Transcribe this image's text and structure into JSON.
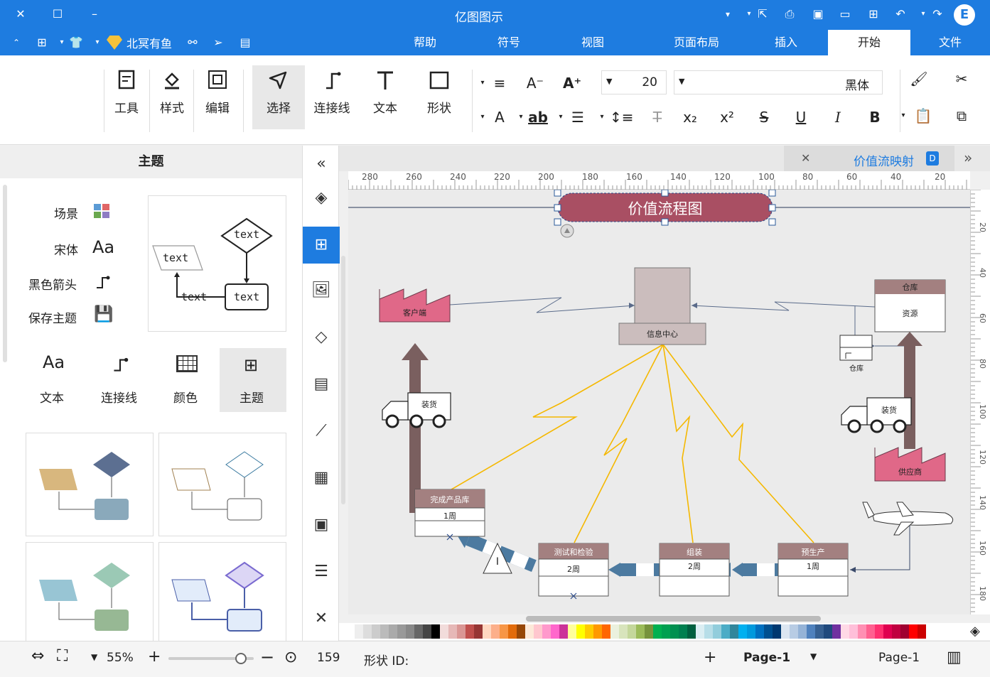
{
  "app": {
    "title": "亿图图示"
  },
  "menu_tabs": [
    "文件",
    "开始",
    "插入",
    "页面布局",
    "视图",
    "符号",
    "帮助"
  ],
  "active_tab": "开始",
  "account": {
    "user": "北冥有鱼"
  },
  "ribbon": {
    "font_name": "黑体",
    "font_size": "20",
    "tools": {
      "shape": "形状",
      "text": "文本",
      "connector": "连接线",
      "select": "选择",
      "edit": "编辑",
      "style": "样式",
      "tools": "工具"
    }
  },
  "left_panel": {
    "title": "主题",
    "theme_options": {
      "scene": "场景",
      "font": "宋体",
      "arrow": "黑色箭头",
      "save": "保存主题"
    },
    "font_icon": "Aa",
    "sample_text": "text",
    "categories": {
      "theme": "主题",
      "color": "颜色",
      "connector": "连接线",
      "text": "文本"
    }
  },
  "document": {
    "tab_title": "价值流映射"
  },
  "ruler": {
    "h_ticks": [
      "20",
      "40",
      "60",
      "80",
      "100",
      "120",
      "140",
      "160",
      "180",
      "200",
      "220",
      "240",
      "260",
      "280"
    ],
    "v_ticks": [
      "20",
      "40",
      "60",
      "80",
      "100",
      "120",
      "140",
      "160",
      "180"
    ]
  },
  "diagram": {
    "title": "价值流程图",
    "info_center": "信息中心",
    "customer": "客户端",
    "supplier": "供应商",
    "warehouse": "仓库",
    "warehouse_body": "资源",
    "warehouse_small": "仓库",
    "truck_label": "装货",
    "process_boxes": [
      {
        "title": "完成产品库",
        "sub": "1周"
      },
      {
        "title": "测试和检验",
        "sub": "2周"
      },
      {
        "title": "组装",
        "sub": "2周"
      },
      {
        "title": "预生产",
        "sub": "1周"
      }
    ],
    "inventory_letter": "I"
  },
  "status": {
    "page_name": "Page-1",
    "page_tab": "Page-1",
    "shape_id_label": "形状 ID:",
    "shape_id": "159",
    "zoom": "55%"
  },
  "colors": {
    "brand": "#1e7ce0",
    "title_shape": "#a94f63",
    "process_header": "#a38080",
    "factory": "#e06888",
    "lightning": "#f5b800",
    "arrow_up": "#7a5f5f",
    "push_arrow": "#4c7aa0"
  }
}
